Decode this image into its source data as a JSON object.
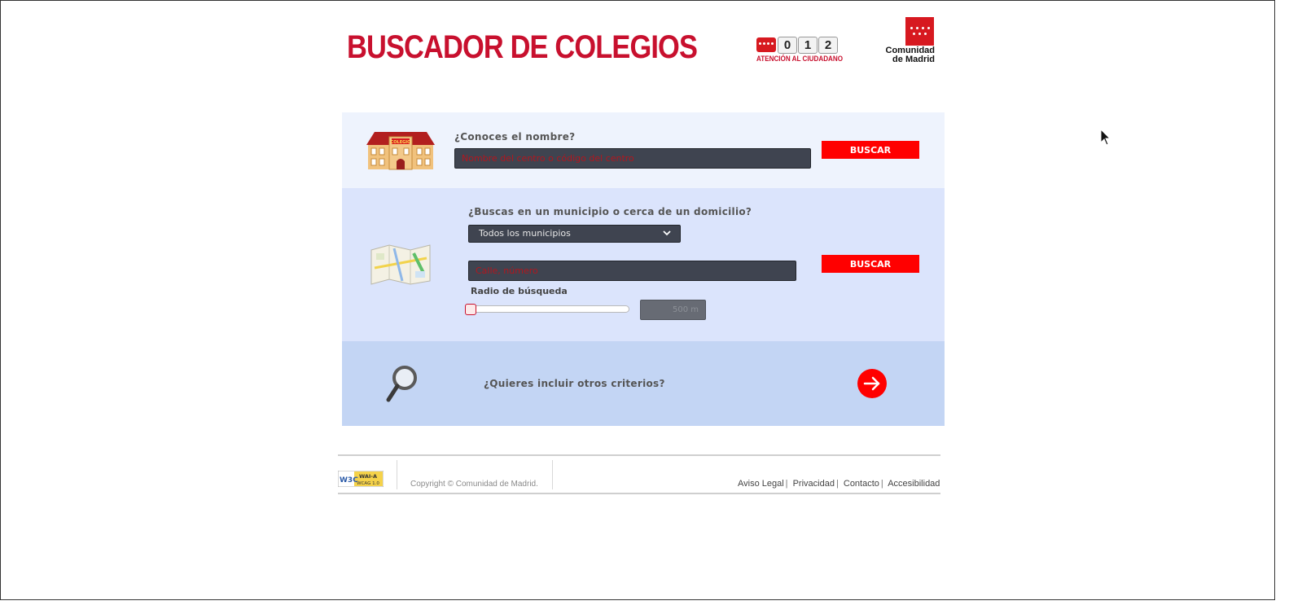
{
  "header": {
    "title": "BUSCADOR DE COLEGIOS",
    "phone_digits": [
      "0",
      "1",
      "2"
    ],
    "phone_caption": "ATENCIÓN AL CIUDADANO",
    "brand_line1": "Comunidad",
    "brand_line2": "de Madrid",
    "brand_color": "#c8102e"
  },
  "search_by_name": {
    "question": "¿Conoces el nombre?",
    "placeholder": "Nombre del centro o código del centro",
    "value": "",
    "button_label": "BUSCAR",
    "image_sign": "COLEGIO",
    "icon": "school-building-icon"
  },
  "search_by_location": {
    "question": "¿Buscas en un municipio o cerca de un domicilio?",
    "municipality_selected": "Todos los municipios",
    "address_placeholder": "Calle, número",
    "address_value": "",
    "button_label": "BUSCAR",
    "radius_label": "Radio de búsqueda",
    "radius_value": "500 m",
    "radius_slider_fraction": 0,
    "icon": "map-icon"
  },
  "more_criteria": {
    "question": "¿Quieres incluir otros criterios?",
    "icon": "magnifier-icon",
    "arrow_icon": "arrow-right-icon"
  },
  "footer": {
    "badge_w3c": "W3C",
    "badge_line1": "WAI-A",
    "badge_line2": "WCAG 1.0",
    "copyright": "Copyright © Comunidad de Madrid.",
    "links": [
      "Aviso Legal",
      "Privacidad",
      "Contacto",
      "Accesibilidad"
    ]
  },
  "colors": {
    "accent_red": "#ff0000",
    "panel_1": "#eef3fd",
    "panel_2": "#dbe4fc",
    "panel_3": "#c3d5f4",
    "input_bg": "#3f4450"
  }
}
